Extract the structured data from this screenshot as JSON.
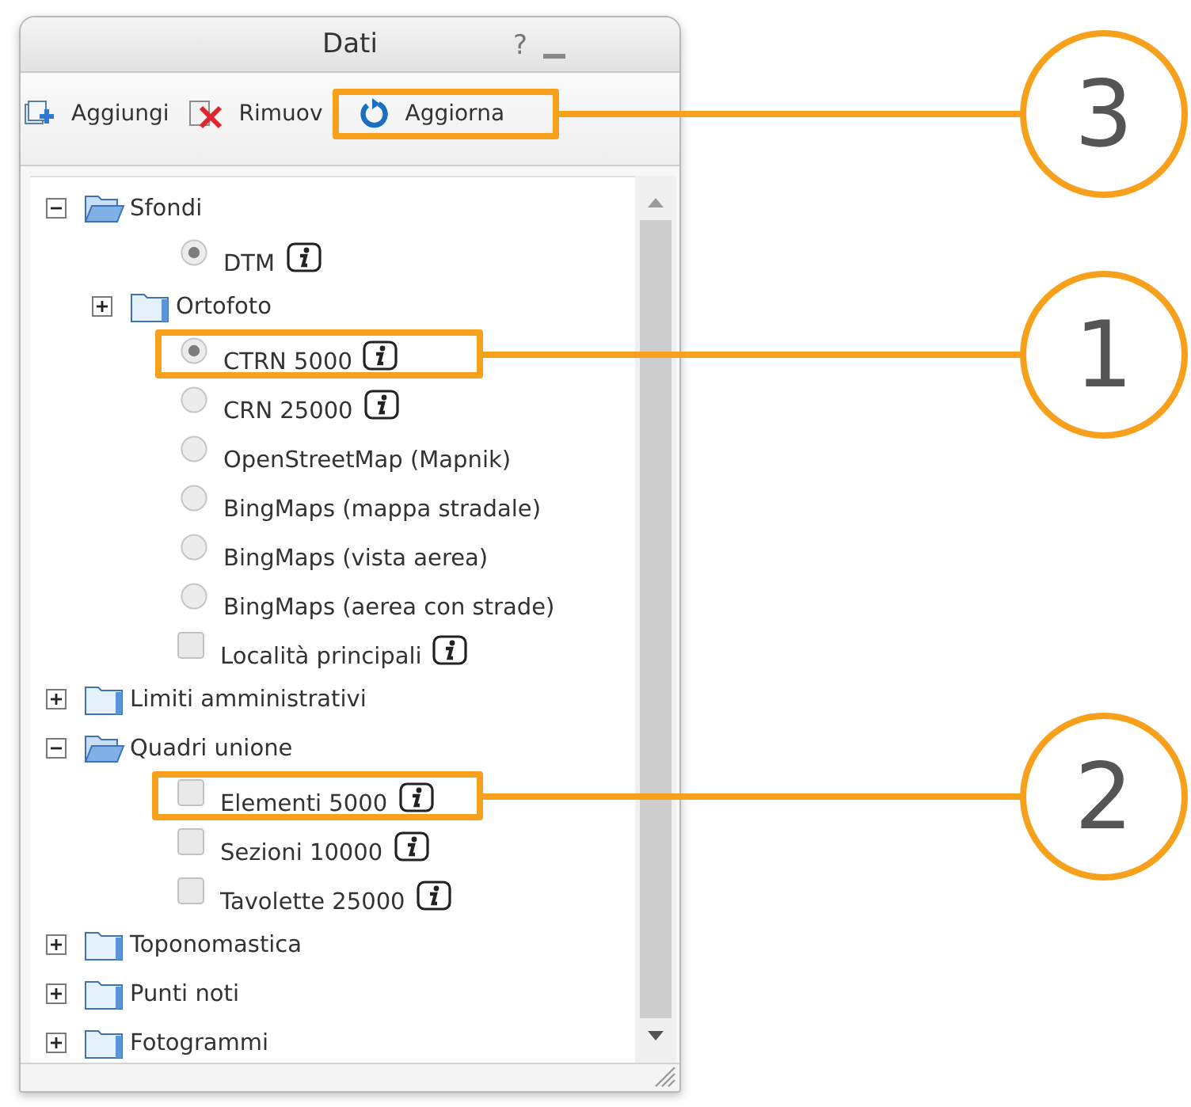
{
  "window": {
    "title": "Dati",
    "help": "?"
  },
  "toolbar": [
    {
      "kind": "add",
      "label": "Aggiungi"
    },
    {
      "kind": "remove",
      "label": "Rimuov"
    },
    {
      "kind": "refresh",
      "label": "Aggiorna",
      "callout": "3"
    }
  ],
  "tree": [
    {
      "kind": "folder",
      "label": "Sfondi",
      "expanded": true,
      "children": [
        {
          "kind": "radio",
          "label": "DTM",
          "selected": true,
          "info": true
        },
        {
          "kind": "folder",
          "label": "Ortofoto",
          "expanded": false
        },
        {
          "kind": "radio",
          "label": "CTRN 5000",
          "selected": true,
          "info": true,
          "callout": "1"
        },
        {
          "kind": "radio",
          "label": "CRN 25000",
          "selected": false,
          "info": true
        },
        {
          "kind": "radio",
          "label": "OpenStreetMap (Mapnik)",
          "selected": false,
          "info": false
        },
        {
          "kind": "radio",
          "label": "BingMaps (mappa stradale)",
          "selected": false,
          "info": false
        },
        {
          "kind": "radio",
          "label": "BingMaps (vista aerea)",
          "selected": false,
          "info": false
        },
        {
          "kind": "radio",
          "label": "BingMaps (aerea con strade)",
          "selected": false,
          "info": false
        },
        {
          "kind": "checkbox",
          "label": "Località principali",
          "checked": false,
          "info": true
        }
      ]
    },
    {
      "kind": "folder",
      "label": "Limiti amministrativi",
      "expanded": false
    },
    {
      "kind": "folder",
      "label": "Quadri unione",
      "expanded": true,
      "children": [
        {
          "kind": "checkbox",
          "label": "Elementi 5000",
          "checked": false,
          "info": true,
          "callout": "2"
        },
        {
          "kind": "checkbox",
          "label": "Sezioni 10000",
          "checked": false,
          "info": true
        },
        {
          "kind": "checkbox",
          "label": "Tavolette 25000",
          "checked": false,
          "info": true
        }
      ]
    },
    {
      "kind": "folder",
      "label": "Toponomastica",
      "expanded": false
    },
    {
      "kind": "folder",
      "label": "Punti noti",
      "expanded": false
    },
    {
      "kind": "folder",
      "label": "Fotogrammi",
      "expanded": false
    }
  ]
}
